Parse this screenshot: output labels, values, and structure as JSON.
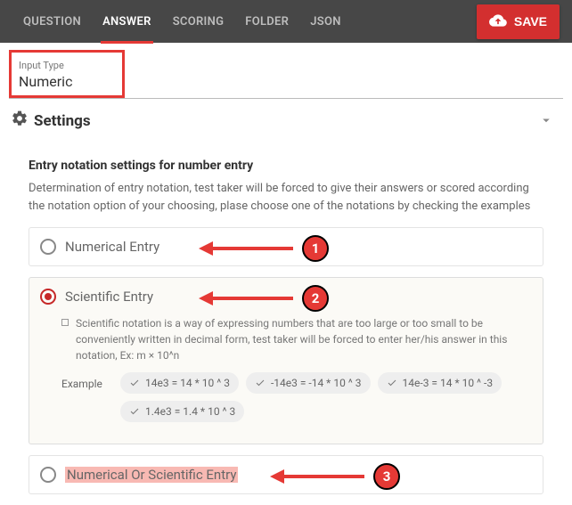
{
  "tabs": [
    "QUESTION",
    "ANSWER",
    "SCORING",
    "FOLDER",
    "JSON"
  ],
  "activeTab": 1,
  "saveLabel": "SAVE",
  "inputType": {
    "label": "Input Type",
    "value": "Numeric"
  },
  "settingsHeader": "Settings",
  "section": {
    "title": "Entry notation settings for number entry",
    "desc": "Determination of entry notation, test taker will be forced to give their answers or scored according the notation option of your choosing, plase choose one of the notations by checking the examples"
  },
  "options": [
    {
      "label": "Numerical Entry",
      "selected": false,
      "highlight": false
    },
    {
      "label": "Scientific Entry",
      "selected": true,
      "highlight": false,
      "desc": "Scientific notation is a way of expressing numbers that are too large or too small to be conveniently written in decimal form, test taker will be forced to enter her/his answer in this notation, Ex: m × 10^n",
      "exampleLabel": "Example",
      "examples": [
        "14e3 = 14 * 10 ^ 3",
        "-14e3 = -14 * 10 ^ 3",
        "14e-3 = 14 * 10 ^ -3",
        "1.4e3 = 1.4 * 10 ^ 3"
      ]
    },
    {
      "label": "Numerical Or Scientific Entry",
      "selected": false,
      "highlight": true
    }
  ],
  "callouts": [
    "1",
    "2",
    "3"
  ]
}
